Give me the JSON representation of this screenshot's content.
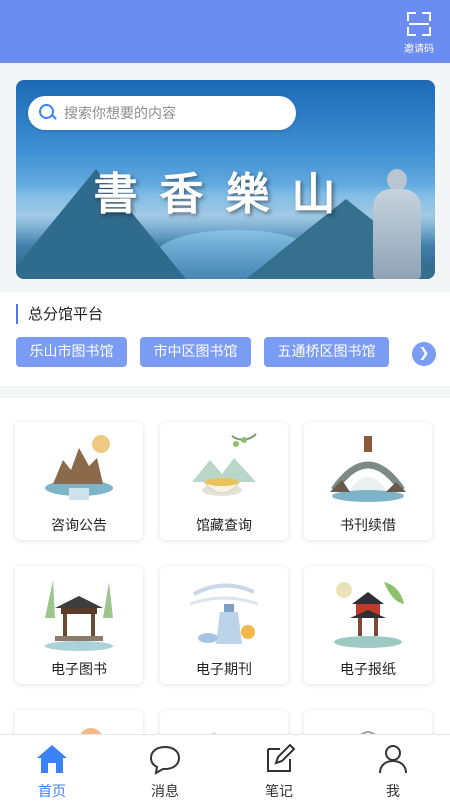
{
  "header": {
    "invite_label": "邀请码",
    "accent_color": "#6b8cf0"
  },
  "banner": {
    "calligraphy": "書香樂山",
    "search_placeholder": "搜索你想要的内容"
  },
  "branches": {
    "title": "总分馆平台",
    "items": [
      "乐山市图书馆",
      "市中区图书馆",
      "五通桥区图书馆"
    ]
  },
  "services": [
    {
      "label": "咨询公告",
      "icon": "rock-garden-icon"
    },
    {
      "label": "馆藏查询",
      "icon": "tea-cup-icon"
    },
    {
      "label": "书刊续借",
      "icon": "bridge-icon"
    },
    {
      "label": "电子图书",
      "icon": "pavilion-icon"
    },
    {
      "label": "电子期刊",
      "icon": "vase-icon"
    },
    {
      "label": "电子报纸",
      "icon": "pagoda-icon"
    }
  ],
  "tabs": [
    {
      "label": "首页",
      "icon": "home-icon"
    },
    {
      "label": "消息",
      "icon": "chat-icon"
    },
    {
      "label": "笔记",
      "icon": "note-icon"
    },
    {
      "label": "我",
      "icon": "user-icon"
    }
  ]
}
